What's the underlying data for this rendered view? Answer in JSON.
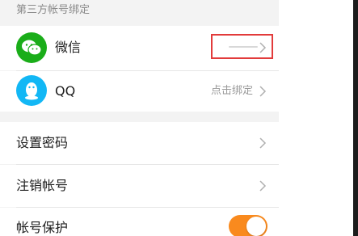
{
  "section": {
    "label": "第三方帐号绑定"
  },
  "bindings": [
    {
      "name": "微信",
      "icon": "wechat-icon",
      "value": "",
      "color": "#1aad19"
    },
    {
      "name": "QQ",
      "icon": "qq-penguin-icon",
      "value": "点击绑定",
      "color": "#12b7f5"
    }
  ],
  "settings": [
    {
      "label": "设置密码"
    },
    {
      "label": "注销帐号"
    },
    {
      "label": "帐号保护",
      "toggle_on": true,
      "toggle_color": "#f98a1e"
    }
  ]
}
